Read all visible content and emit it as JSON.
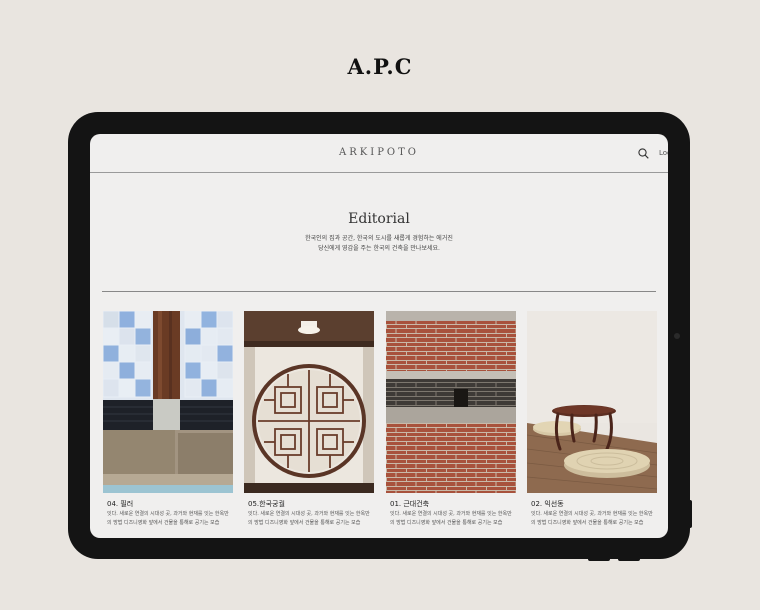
{
  "brand": "A.P.C",
  "site": {
    "logo": "ARKIPOTO",
    "login": "Log",
    "search_icon": "search-icon"
  },
  "hero": {
    "title": "Editorial",
    "description_line1": "한국인의 집과 공간, 한국의 도시를 새롭게 경험하는 에거진",
    "description_line2": "당신에게 영감을 주는 한국의 건축을 만나보세요."
  },
  "cards": [
    {
      "title": "04. 필러",
      "description": "잇다. 새로운 연결의 시대성 곳, 과거와 현재를 잇는 한옥만의 방법 디즈니영화 앞에서 건물을 통해로 공기는 모습"
    },
    {
      "title": "05.한국궁궐",
      "description": "잇다. 새로운 연결의 시대성 곳, 과거와 현재를 잇는 한옥만의 방법 디즈니영화 앞에서 건물을 통해로 공기는 모습"
    },
    {
      "title": "01. 근대건축",
      "description": "잇다. 새로운 연결의 시대성 곳, 과거와 현재를 잇는 한옥만의 방법 디즈니영화 앞에서 건물을 통해로 공기는 모습"
    },
    {
      "title": "02. 익선동",
      "description": "잇다. 새로운 연결의 시대성 곳, 과거와 현재를 잇는 한옥만의 방법 디즈니영화 앞에서 건물을 통해로 공기는 모습"
    }
  ],
  "colors": {
    "background": "#e9e5e0",
    "device": "#141414",
    "screen": "#f0efee"
  }
}
